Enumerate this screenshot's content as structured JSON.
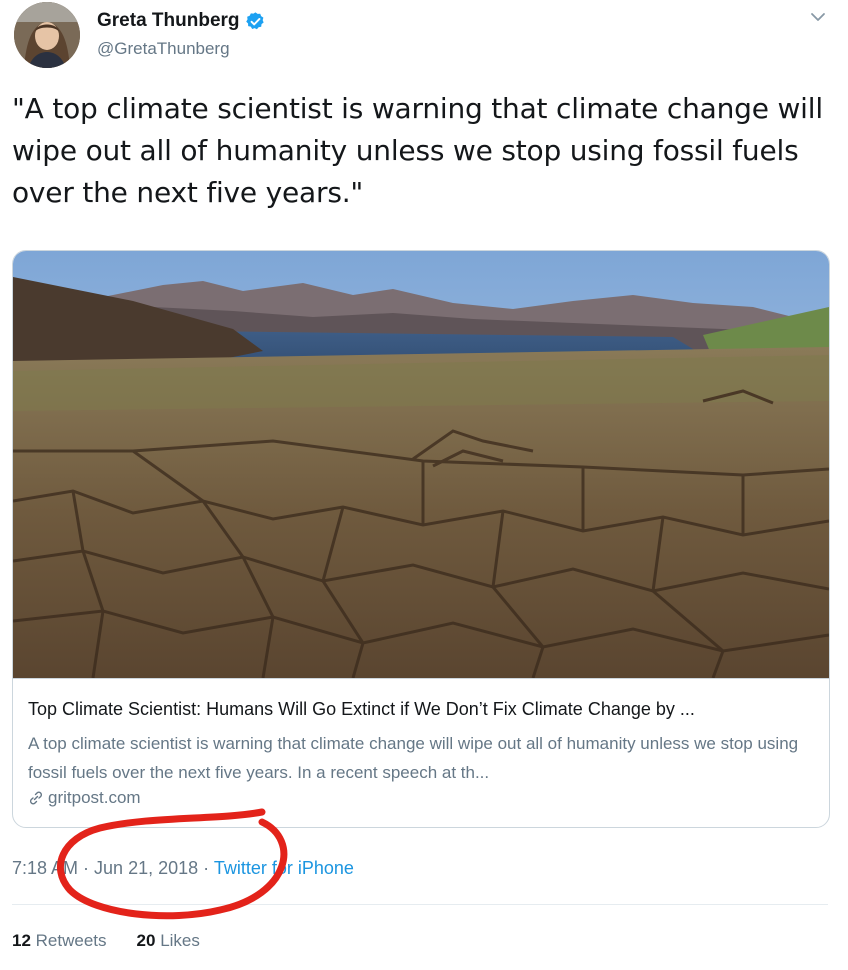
{
  "author": {
    "display_name": "Greta Thunberg",
    "handle": "@GretaThunberg",
    "verified_icon": "verified-badge-icon",
    "avatar_icon": "avatar"
  },
  "tweet": {
    "text": "\"A top climate scientist is warning that climate change will wipe out all of humanity unless we stop using fossil fuels over the next five years.\""
  },
  "card": {
    "image_icon": "cracked-dry-lakebed-photo",
    "title": "Top Climate Scientist: Humans Will Go Extinct if We Don’t Fix Climate Change by ...",
    "description": "A top climate scientist is warning that climate change will wipe out all of humanity unless we stop using fossil fuels over the next five years. In a recent speech at th...",
    "domain": "gritpost.com",
    "link_icon": "link-icon"
  },
  "meta": {
    "time": "7:18 AM",
    "separator": " · ",
    "date": "Jun 21, 2018",
    "source": "Twitter for iPhone"
  },
  "stats": {
    "retweets_count": "12",
    "retweets_label": "Retweets",
    "likes_count": "20",
    "likes_label": "Likes"
  },
  "colors": {
    "link_blue": "#1b95e0",
    "secondary_text": "#657786",
    "annotation_red": "#e3231a"
  }
}
